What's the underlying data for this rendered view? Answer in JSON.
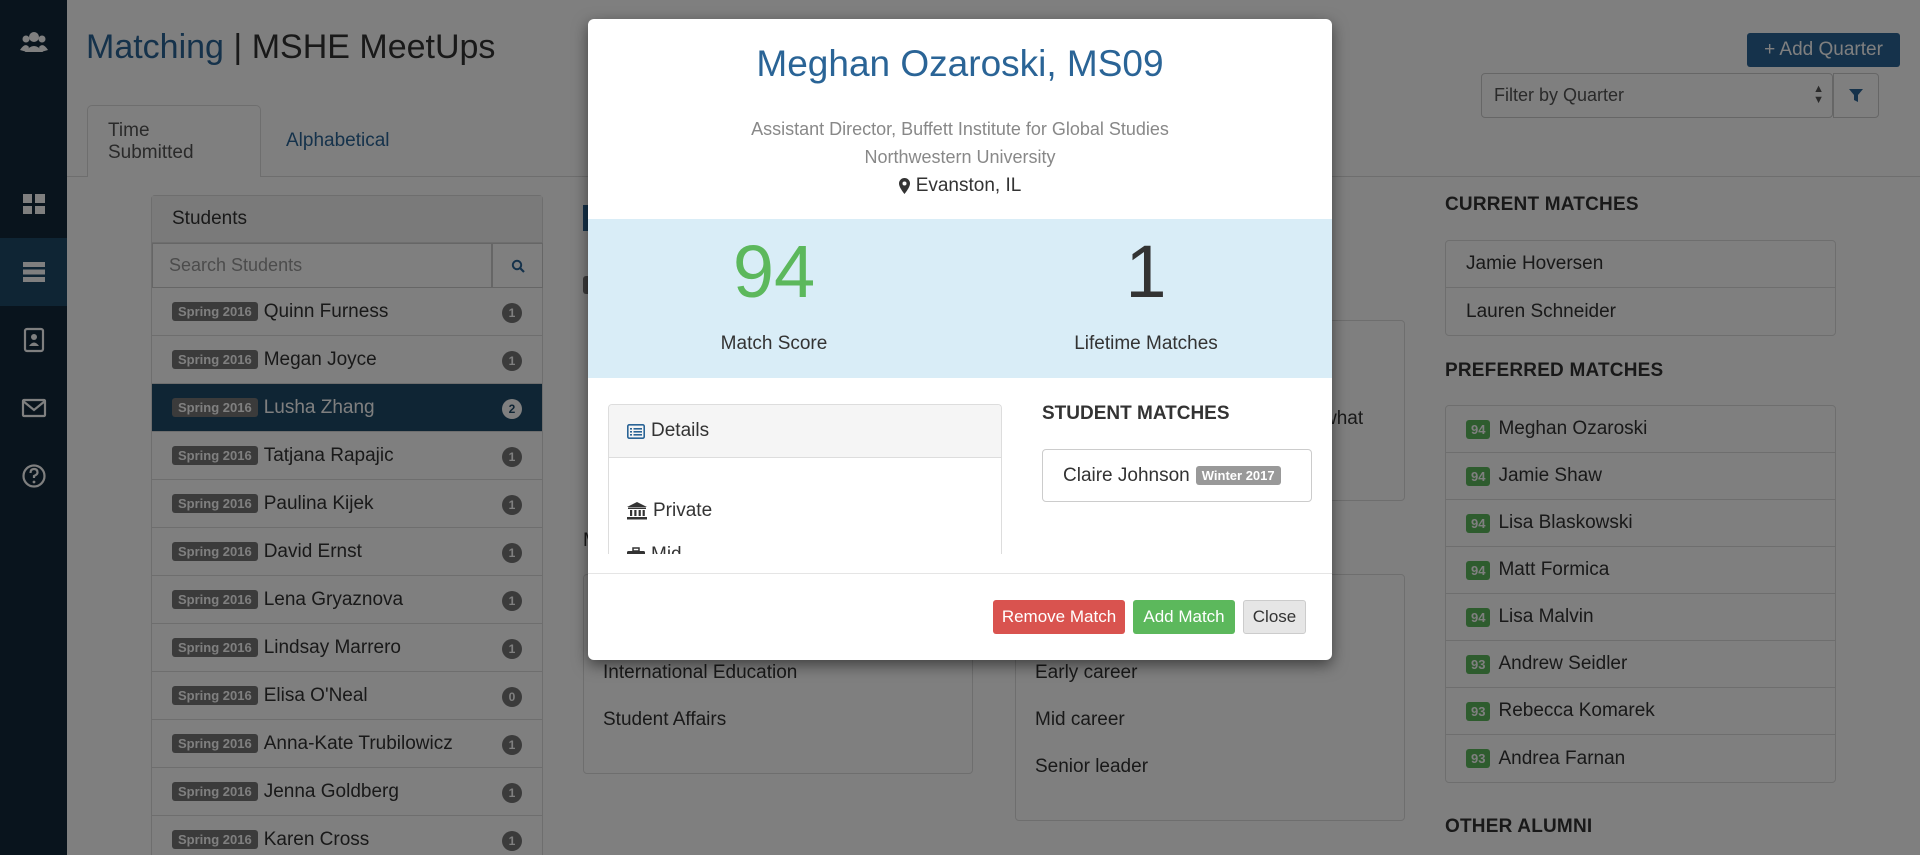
{
  "header": {
    "title_link": "Matching",
    "title_sep": " | ",
    "title_rest": "MSHE MeetUps",
    "add_quarter": "+ Add Quarter",
    "filter_placeholder": "Filter by Quarter"
  },
  "tabs": [
    {
      "label": "Time Submitted"
    },
    {
      "label": "Alphabetical"
    }
  ],
  "students": {
    "heading": "Students",
    "search_placeholder": "Search Students",
    "items": [
      {
        "quarter": "Spring 2016",
        "name": "Quinn Furness",
        "count": "1"
      },
      {
        "quarter": "Spring 2016",
        "name": "Megan Joyce",
        "count": "1"
      },
      {
        "quarter": "Spring 2016",
        "name": "Lusha Zhang",
        "count": "2"
      },
      {
        "quarter": "Spring 2016",
        "name": "Tatjana Rapajic",
        "count": "1"
      },
      {
        "quarter": "Spring 2016",
        "name": "Paulina Kijek",
        "count": "1"
      },
      {
        "quarter": "Spring 2016",
        "name": "David Ernst",
        "count": "1"
      },
      {
        "quarter": "Spring 2016",
        "name": "Lena Gryaznova",
        "count": "1"
      },
      {
        "quarter": "Spring 2016",
        "name": "Lindsay Marrero",
        "count": "1"
      },
      {
        "quarter": "Spring 2016",
        "name": "Elisa O'Neal",
        "count": "0"
      },
      {
        "quarter": "Spring 2016",
        "name": "Anna-Kate Trubilowicz",
        "count": "1"
      },
      {
        "quarter": "Spring 2016",
        "name": "Jenna Goldberg",
        "count": "1"
      },
      {
        "quarter": "Spring 2016",
        "name": "Karen Cross",
        "count": "1"
      }
    ]
  },
  "middle": {
    "frag_what": "what",
    "frag_m": "M",
    "interests": [
      "International Education",
      "Student Affairs"
    ],
    "career": [
      "Early career",
      "Mid career",
      "Senior leader"
    ]
  },
  "right": {
    "current_heading": "CURRENT MATCHES",
    "current": [
      "Jamie Hoversen",
      "Lauren Schneider"
    ],
    "preferred_heading": "PREFERRED MATCHES",
    "preferred": [
      {
        "score": "94",
        "name": "Meghan Ozaroski"
      },
      {
        "score": "94",
        "name": "Jamie Shaw"
      },
      {
        "score": "94",
        "name": "Lisa Blaskowski"
      },
      {
        "score": "94",
        "name": "Matt Formica"
      },
      {
        "score": "94",
        "name": "Lisa Malvin"
      },
      {
        "score": "93",
        "name": "Andrew Seidler"
      },
      {
        "score": "93",
        "name": "Rebecca Komarek"
      },
      {
        "score": "93",
        "name": "Andrea Farnan"
      }
    ],
    "other_heading": "OTHER ALUMNI"
  },
  "modal": {
    "name": "Meghan Ozaroski, MS09",
    "position": "Assistant Director, Buffett Institute for Global Studies",
    "org": "Northwestern University",
    "location": "Evanston, IL",
    "match_score": "94",
    "match_score_label": "Match Score",
    "lifetime": "1",
    "lifetime_label": "Lifetime Matches",
    "details_heading": "Details",
    "detail_private": "Private",
    "detail_partial": "Mid",
    "student_matches_heading": "STUDENT MATCHES",
    "student_match_name": "Claire Johnson",
    "student_match_quarter": "Winter 2017",
    "btn_remove": "Remove Match",
    "btn_add": "Add Match",
    "btn_close": "Close"
  },
  "colors": {
    "sidebar": "#12293b",
    "sidebar_active": "#1f4a69",
    "link": "#2a6496",
    "score_green": "#5cb85c",
    "stats_bg": "#d9edf7",
    "remove_red": "#d9534f"
  }
}
